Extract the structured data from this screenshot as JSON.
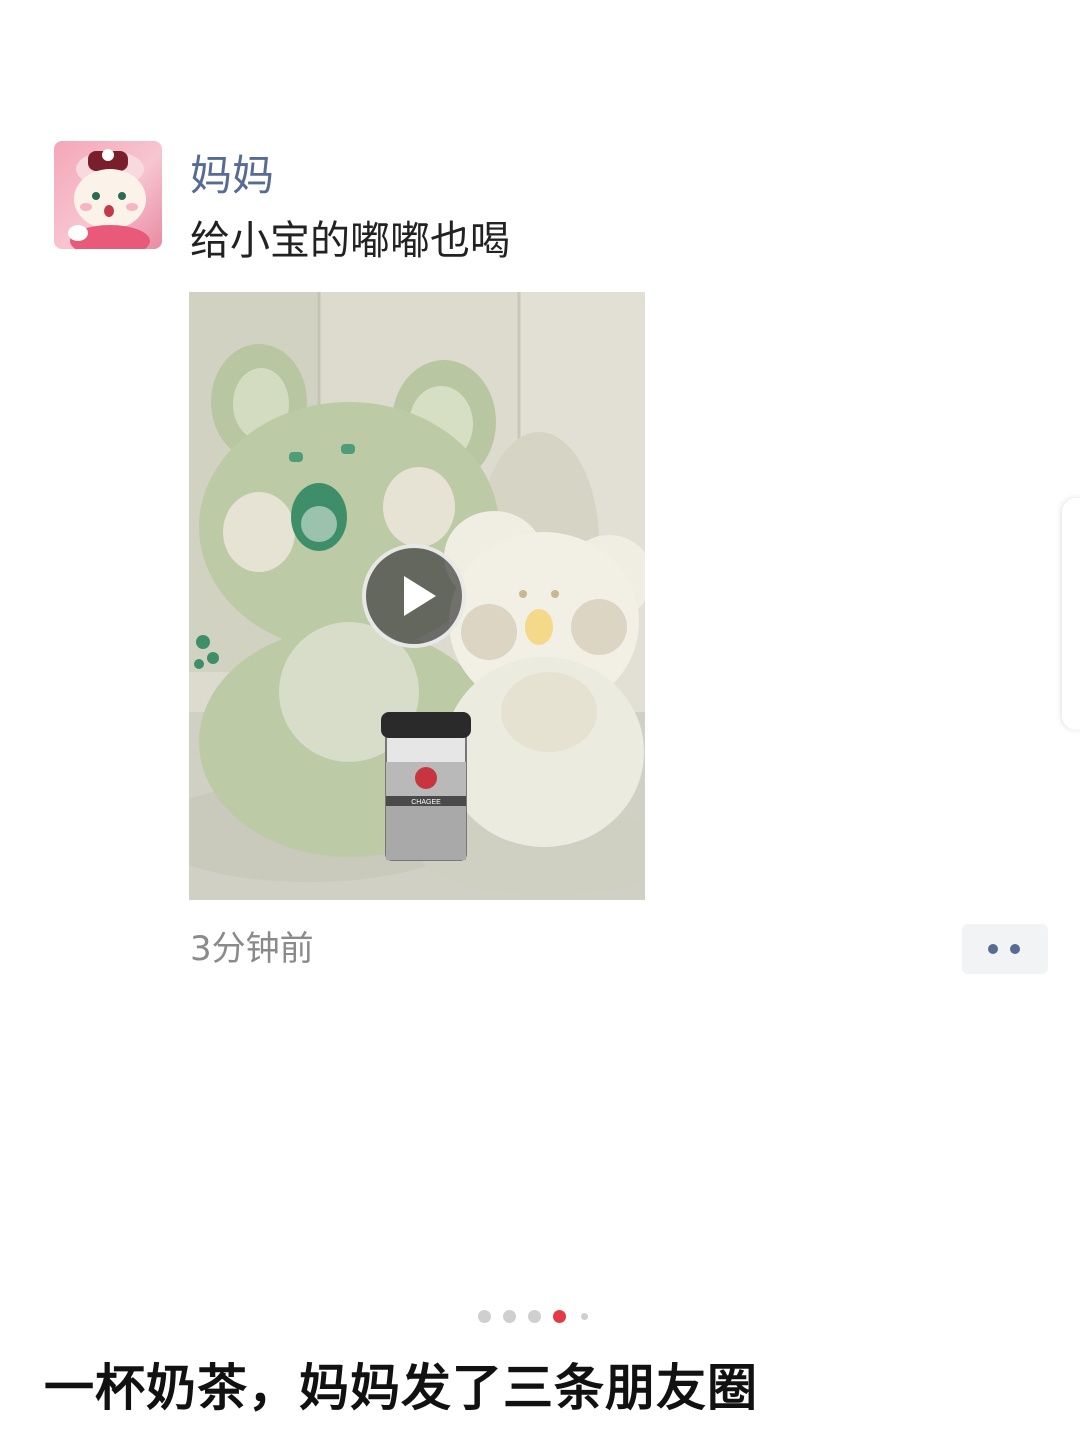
{
  "post": {
    "author": "妈妈",
    "text": "给小宝的嘟嘟也喝",
    "timestamp": "3分钟前",
    "media": {
      "type": "video",
      "cup_label": "CHAGEE"
    }
  },
  "pager": {
    "count": 5,
    "active_index": 3
  },
  "caption": "一杯奶茶，妈妈发了三条朋友圈",
  "colors": {
    "username": "#576b95",
    "timestamp": "#8a8a8a",
    "pager_active": "#e63946",
    "pager_inactive": "#cfcfcf"
  }
}
